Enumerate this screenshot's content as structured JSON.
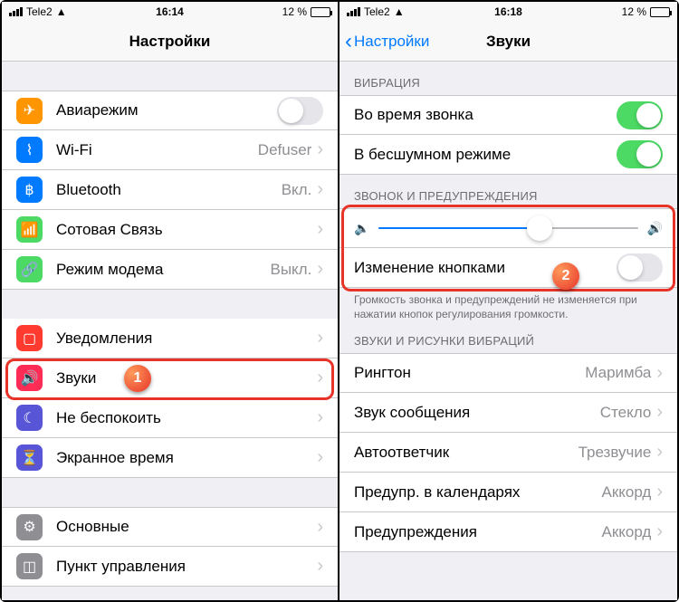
{
  "left": {
    "status": {
      "carrier": "Tele2",
      "time": "16:14",
      "battery_text": "12 %"
    },
    "nav": {
      "title": "Настройки"
    },
    "group1": [
      {
        "icon": "airplane",
        "color": "#ff9500",
        "label": "Авиарежим",
        "type": "toggle",
        "on": false
      },
      {
        "icon": "wifi",
        "color": "#007aff",
        "label": "Wi-Fi",
        "detail": "Defuser",
        "type": "push"
      },
      {
        "icon": "bluetooth",
        "color": "#007aff",
        "label": "Bluetooth",
        "detail": "Вкл.",
        "type": "push"
      },
      {
        "icon": "cellular",
        "color": "#4cd964",
        "label": "Сотовая Связь",
        "type": "push"
      },
      {
        "icon": "hotspot",
        "color": "#4cd964",
        "label": "Режим модема",
        "detail": "Выкл.",
        "type": "push"
      }
    ],
    "group2": [
      {
        "icon": "notifications",
        "color": "#ff3b30",
        "label": "Уведомления"
      },
      {
        "icon": "sounds",
        "color": "#ff2d55",
        "label": "Звуки"
      },
      {
        "icon": "dnd",
        "color": "#5856d6",
        "label": "Не беспокоить"
      },
      {
        "icon": "screentime",
        "color": "#5856d6",
        "label": "Экранное время"
      }
    ],
    "group3": [
      {
        "icon": "general",
        "color": "#8e8e93",
        "label": "Основные"
      },
      {
        "icon": "controlcenter",
        "color": "#8e8e93",
        "label": "Пункт управления"
      }
    ],
    "badge1": "1"
  },
  "right": {
    "status": {
      "carrier": "Tele2",
      "time": "16:18",
      "battery_text": "12 %"
    },
    "nav": {
      "back": "Настройки",
      "title": "Звуки"
    },
    "header_vibration": "ВИБРАЦИЯ",
    "vibration": [
      {
        "label": "Во время звонка",
        "on": true
      },
      {
        "label": "В бесшумном режиме",
        "on": true
      }
    ],
    "header_ringer": "ЗВОНОК И ПРЕДУПРЕЖДЕНИЯ",
    "slider_value": 62,
    "change_buttons": {
      "label": "Изменение кнопками",
      "on": false
    },
    "footer_ringer": "Громкость звонка и предупреждений не изменяется при нажатии кнопок регулирования громкости.",
    "header_sounds": "ЗВУКИ И РИСУНКИ ВИБРАЦИЙ",
    "sounds": [
      {
        "label": "Рингтон",
        "detail": "Маримба"
      },
      {
        "label": "Звук сообщения",
        "detail": "Стекло"
      },
      {
        "label": "Автоответчик",
        "detail": "Трезвучие"
      },
      {
        "label": "Предупр. в календарях",
        "detail": "Аккорд"
      },
      {
        "label": "Предупреждения",
        "detail": "Аккорд"
      }
    ],
    "badge2": "2"
  }
}
